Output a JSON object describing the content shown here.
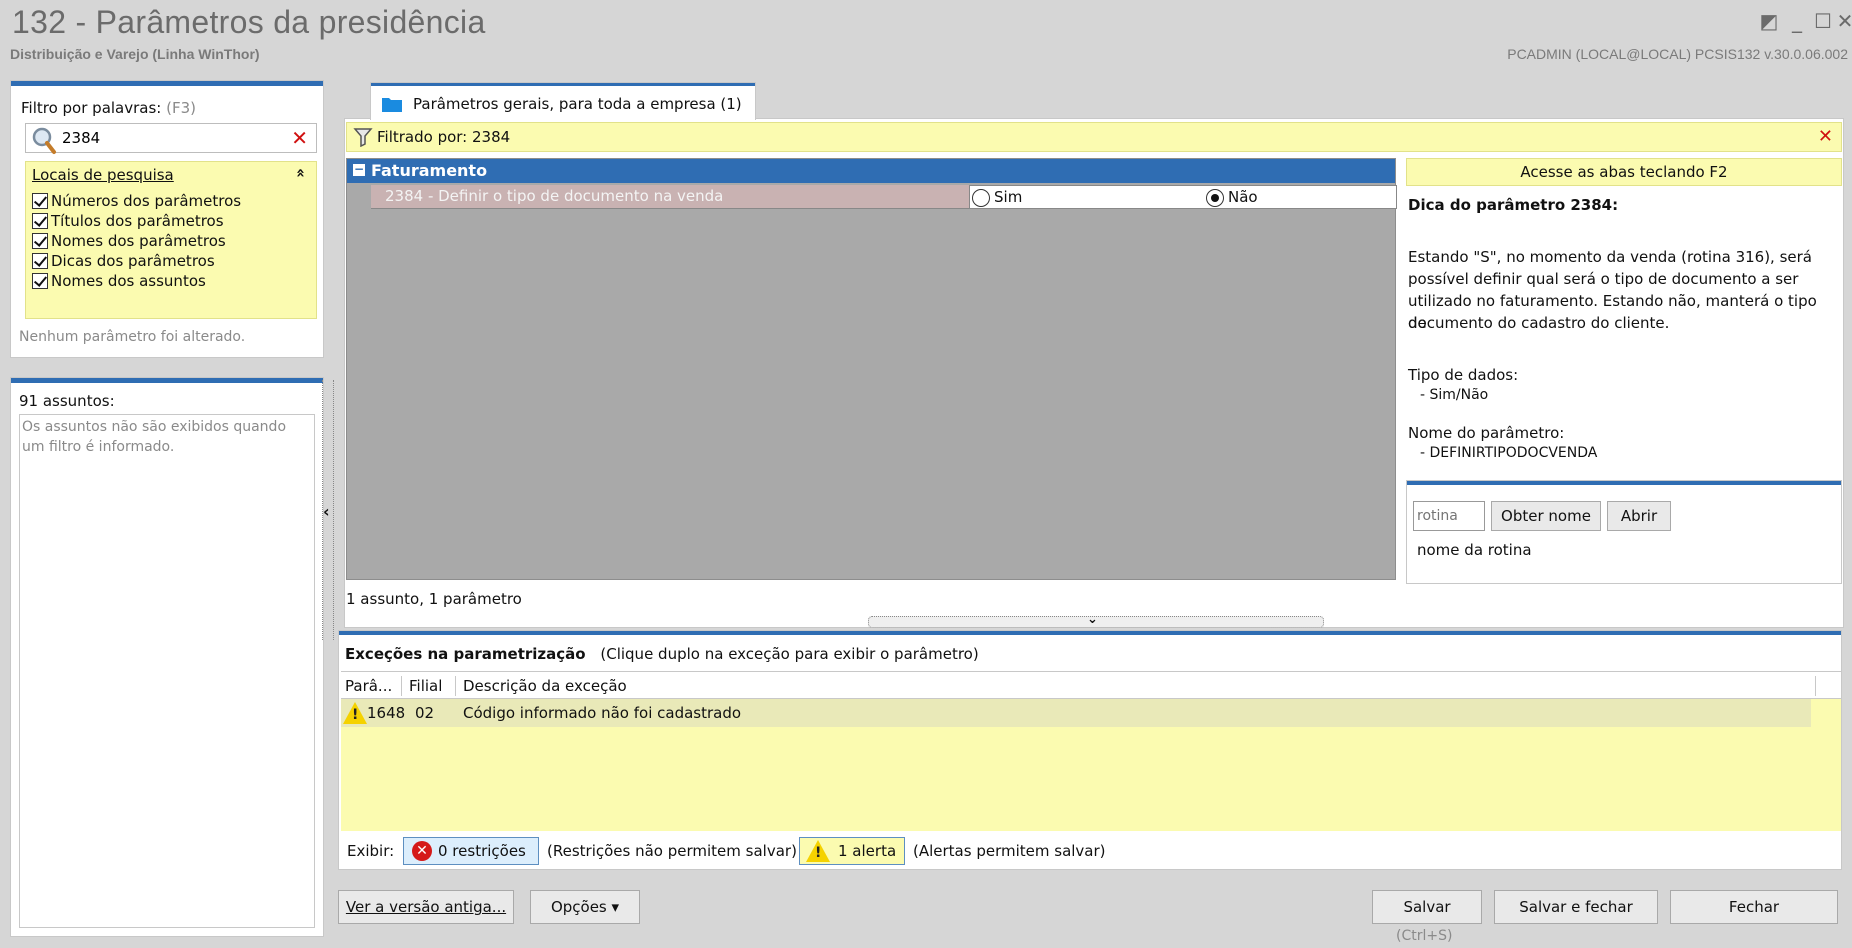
{
  "window": {
    "title": "132 - Parâmetros da presidência",
    "subtitle": "Distribuição e Varejo (Linha WinThor)",
    "user_info": "PCADMIN (LOCAL@LOCAL)   PCSIS132  v.30.0.06.002",
    "controls": {
      "restore": "◩",
      "minimize": "_",
      "maximize": "☐",
      "close": "✕"
    }
  },
  "filter_panel": {
    "label": "Filtro por palavras:",
    "shortcut": "(F3)",
    "search_value": "2384",
    "clear_symbol": "✕",
    "locais_title": "Locais de pesquisa",
    "collapse_symbol": "«",
    "checkboxes": [
      {
        "label": "Números dos parâmetros",
        "checked": true
      },
      {
        "label": "Títulos dos parâmetros",
        "checked": true
      },
      {
        "label": "Nomes dos parâmetros",
        "checked": true
      },
      {
        "label": "Dicas dos parâmetros",
        "checked": true
      },
      {
        "label": "Nomes dos assuntos",
        "checked": true
      }
    ],
    "status": "Nenhum parâmetro foi alterado."
  },
  "subjects_panel": {
    "count": "91 assuntos:",
    "message_line1": "Os assuntos não são exibidos quando",
    "message_line2": "um filtro é informado.",
    "collapse_symbol": "‹"
  },
  "main": {
    "tab_label": "Parâmetros gerais, para toda a empresa  (1)",
    "filter_label": "Filtrado por: 2384",
    "filter_clear": "✕",
    "group": {
      "toggle": "−",
      "name": "Faturamento"
    },
    "param": {
      "label": "2384 - Definir o tipo de documento na venda",
      "option_yes": "Sim",
      "option_no": "Não",
      "selected": "Não"
    },
    "summary": "1 assunto, 1 parâmetro"
  },
  "tip_panel": {
    "header": "Acesse as abas teclando F2",
    "title": "Dica do parâmetro 2384:",
    "description_lines": [
      "Estando \"S\", no momento da venda (rotina 316), será",
      "possível definir qual será o tipo de documento a ser",
      "utilizado no faturamento. Estando não, manterá o tipo de",
      "documento do cadastro do cliente."
    ],
    "data_type_label": "Tipo de dados:",
    "data_type_value": "- Sim/Não",
    "param_name_label": "Nome do parâmetro:",
    "param_name_value": "- DEFINIRTIPODOCVENDA",
    "rotina_placeholder": "rotina",
    "get_name_button": "Obter nome",
    "open_button": "Abrir",
    "rotina_name": "nome da rotina"
  },
  "exceptions": {
    "title": "Exceções na parametrização",
    "hint": "(Clique duplo na exceção para exibir o parâmetro)",
    "columns": [
      "Parâ...",
      "Filial",
      "Descrição da exceção"
    ],
    "rows": [
      {
        "param": "1648",
        "filial": "02",
        "description": "Código informado não foi cadastrado"
      }
    ],
    "show_label": "Exibir:",
    "restrictions_button": "0 restrições",
    "restrictions_note": "(Restrições não permitem salvar)",
    "alerts_button": "1 alerta",
    "alerts_note": "(Alertas permitem salvar)"
  },
  "footer": {
    "old_version_button": "Ver a versão antiga...",
    "options_button": "Opções ▾",
    "save_button": "Salvar",
    "save_shortcut": "(Ctrl+S)",
    "save_close_button": "Salvar e fechar",
    "close_button": "Fechar"
  }
}
